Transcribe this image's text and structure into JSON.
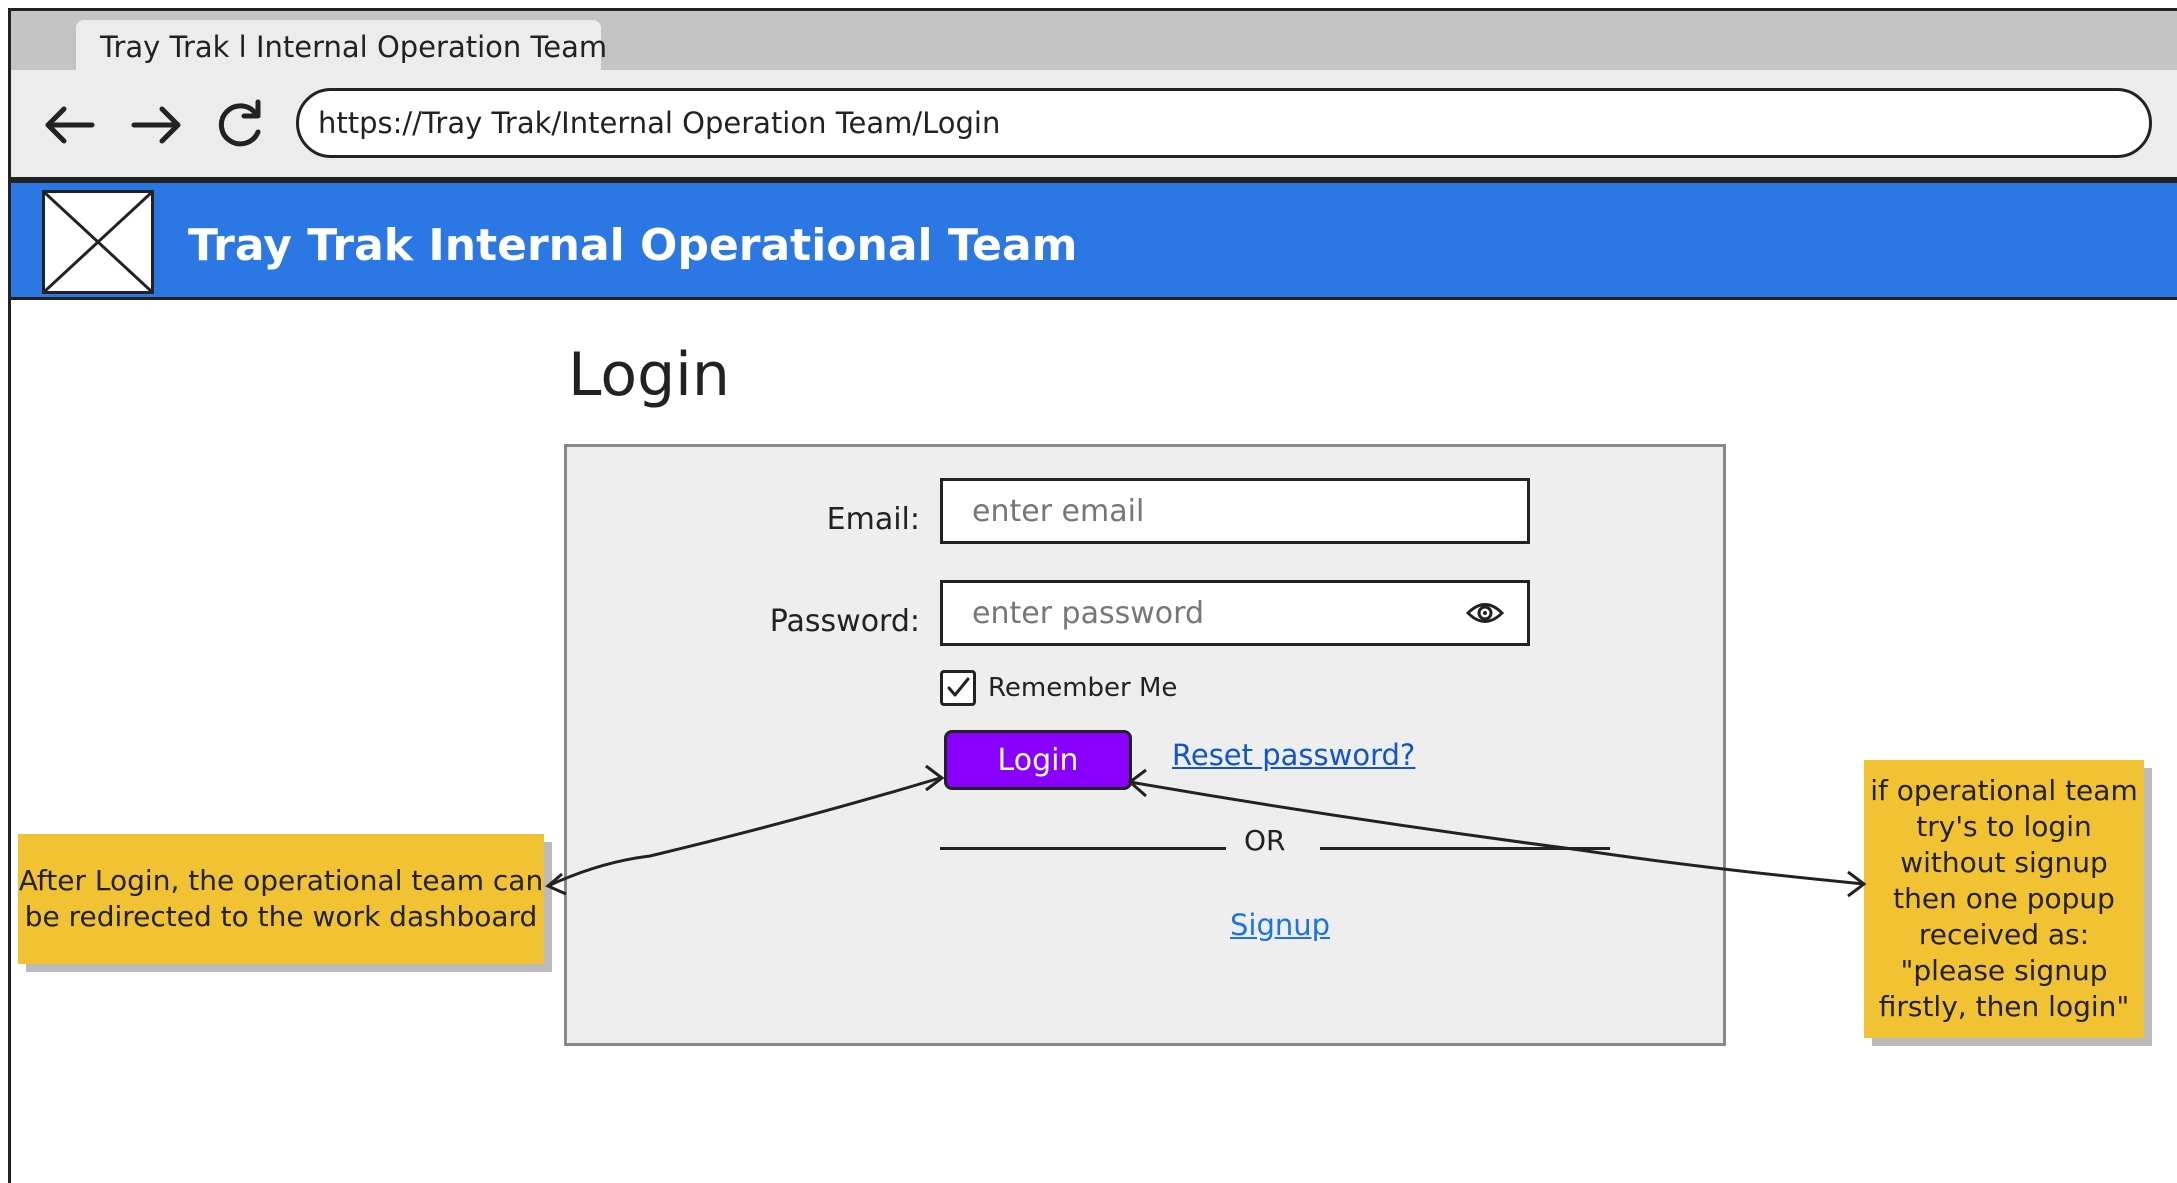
{
  "browser": {
    "tab_title": "Tray Trak l Internal Operation Team",
    "url": "https://Tray Trak/Internal Operation Team/Login",
    "icons": [
      "back-arrow-icon",
      "forward-arrow-icon",
      "reload-icon"
    ]
  },
  "header": {
    "title": "Tray Trak Internal Operational Team",
    "logo_icon": "image-placeholder-icon",
    "color": "#2b78e4"
  },
  "page": {
    "heading": "Login"
  },
  "form": {
    "email_label": "Email:",
    "email_placeholder": "enter email",
    "password_label": "Password:",
    "password_placeholder": "enter password",
    "password_toggle_icon": "eye-icon",
    "remember_label": "Remember Me",
    "remember_checked": true,
    "login_label": "Login",
    "login_color": "#8a00ff",
    "reset_label": "Reset password?",
    "or_label": "OR",
    "signup_label": "Signup"
  },
  "notes": {
    "left": "After Login, the operational team can be redirected to the work dashboard",
    "right": "if operational team try's to login without signup then one popup received as: \"please signup firstly, then login\"",
    "color": "#f1c232"
  }
}
